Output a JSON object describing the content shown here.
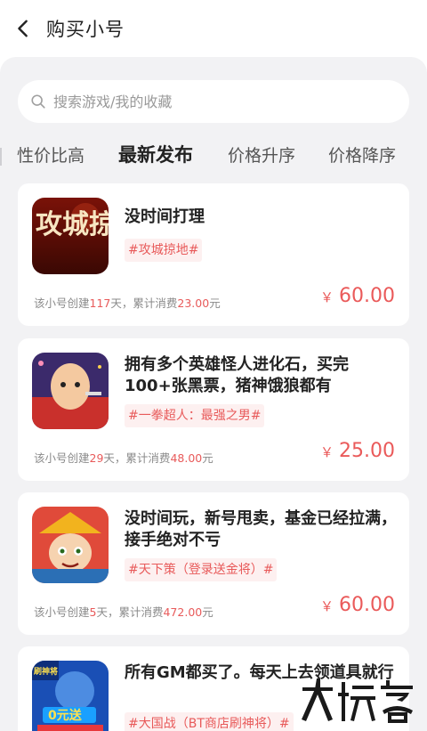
{
  "header": {
    "title": "购买小号"
  },
  "search": {
    "placeholder": "搜索游戏/我的收藏"
  },
  "tabs": [
    {
      "label": "性价比高"
    },
    {
      "label": "最新发布"
    },
    {
      "label": "价格升序"
    },
    {
      "label": "价格降序"
    }
  ],
  "active_tab": "最新发布",
  "meta_labels": {
    "created_prefix": "该小号创建",
    "day_suffix": "天，累计消费",
    "yuan": "元"
  },
  "listings": [
    {
      "title": "没时间打理",
      "tag": "#攻城掠地#",
      "days": "117",
      "spend": "23.00",
      "price": "60.00",
      "currency": "￥"
    },
    {
      "title": "拥有多个英雄怪人进化石，买完100+张黑票，猪神饿狼都有",
      "tag": "#一拳超人：最强之男#",
      "days": "29",
      "spend": "48.00",
      "price": "25.00",
      "currency": "￥"
    },
    {
      "title": "没时间玩，新号甩卖，基金已经拉满，接手绝对不亏",
      "tag": "#天下策（登录送金将）#",
      "days": "5",
      "spend": "472.00",
      "price": "60.00",
      "currency": "￥"
    },
    {
      "title": "所有GM都买了。每天上去领道具就行",
      "tag": "#大国战（BT商店刷神将）#"
    }
  ],
  "icon_text": {
    "game1": "攻城掠地",
    "game4_top": "刷神将",
    "game4_mid": "0元送"
  },
  "colors": {
    "accent": "#ea5a5a",
    "panel_bg": "#f2f2f4"
  }
}
